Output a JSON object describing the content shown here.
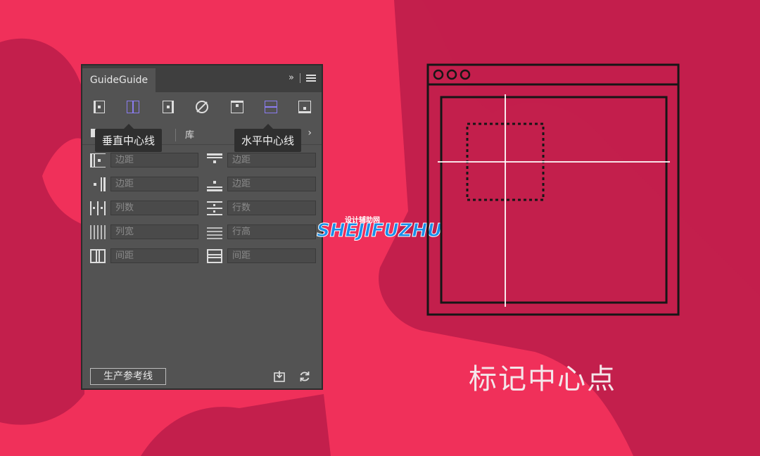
{
  "panel": {
    "tab_title": "GuideGuide",
    "title_arrows": "»",
    "toolbar_icons": [
      "left-margin-guide-icon",
      "vertical-center-icon",
      "right-margin-guide-icon",
      "clear-guides-icon",
      "top-margin-guide-icon",
      "horizontal-center-icon",
      "bottom-margin-guide-icon"
    ],
    "subtab_library": "库",
    "tooltips": {
      "vertical_center": "垂直中心线",
      "horizontal_center": "水平中心线"
    },
    "left_fields": [
      {
        "icon": "left-margin-icon",
        "placeholder": "边距"
      },
      {
        "icon": "right-margin-icon",
        "placeholder": "边距"
      },
      {
        "icon": "columns-icon",
        "placeholder": "列数"
      },
      {
        "icon": "column-width-icon",
        "placeholder": "列宽"
      },
      {
        "icon": "column-gutter-icon",
        "placeholder": "间距"
      }
    ],
    "right_fields": [
      {
        "icon": "top-margin-icon",
        "placeholder": "边距"
      },
      {
        "icon": "bottom-margin-icon",
        "placeholder": "边距"
      },
      {
        "icon": "rows-icon",
        "placeholder": "行数"
      },
      {
        "icon": "row-height-icon",
        "placeholder": "行高"
      },
      {
        "icon": "row-gutter-icon",
        "placeholder": "间距"
      }
    ],
    "generate_button": "生产参考线",
    "bottom_icons": [
      "import-icon",
      "refresh-icon"
    ]
  },
  "watermark": {
    "small": "设计辅助网",
    "big": "SHEJIFUZHU"
  },
  "caption": "标记中心点",
  "colors": {
    "background": "#f0305a",
    "dark_shape": "#c31f4c",
    "panel": "#535353",
    "accent_icon": "#8b7cf0"
  }
}
